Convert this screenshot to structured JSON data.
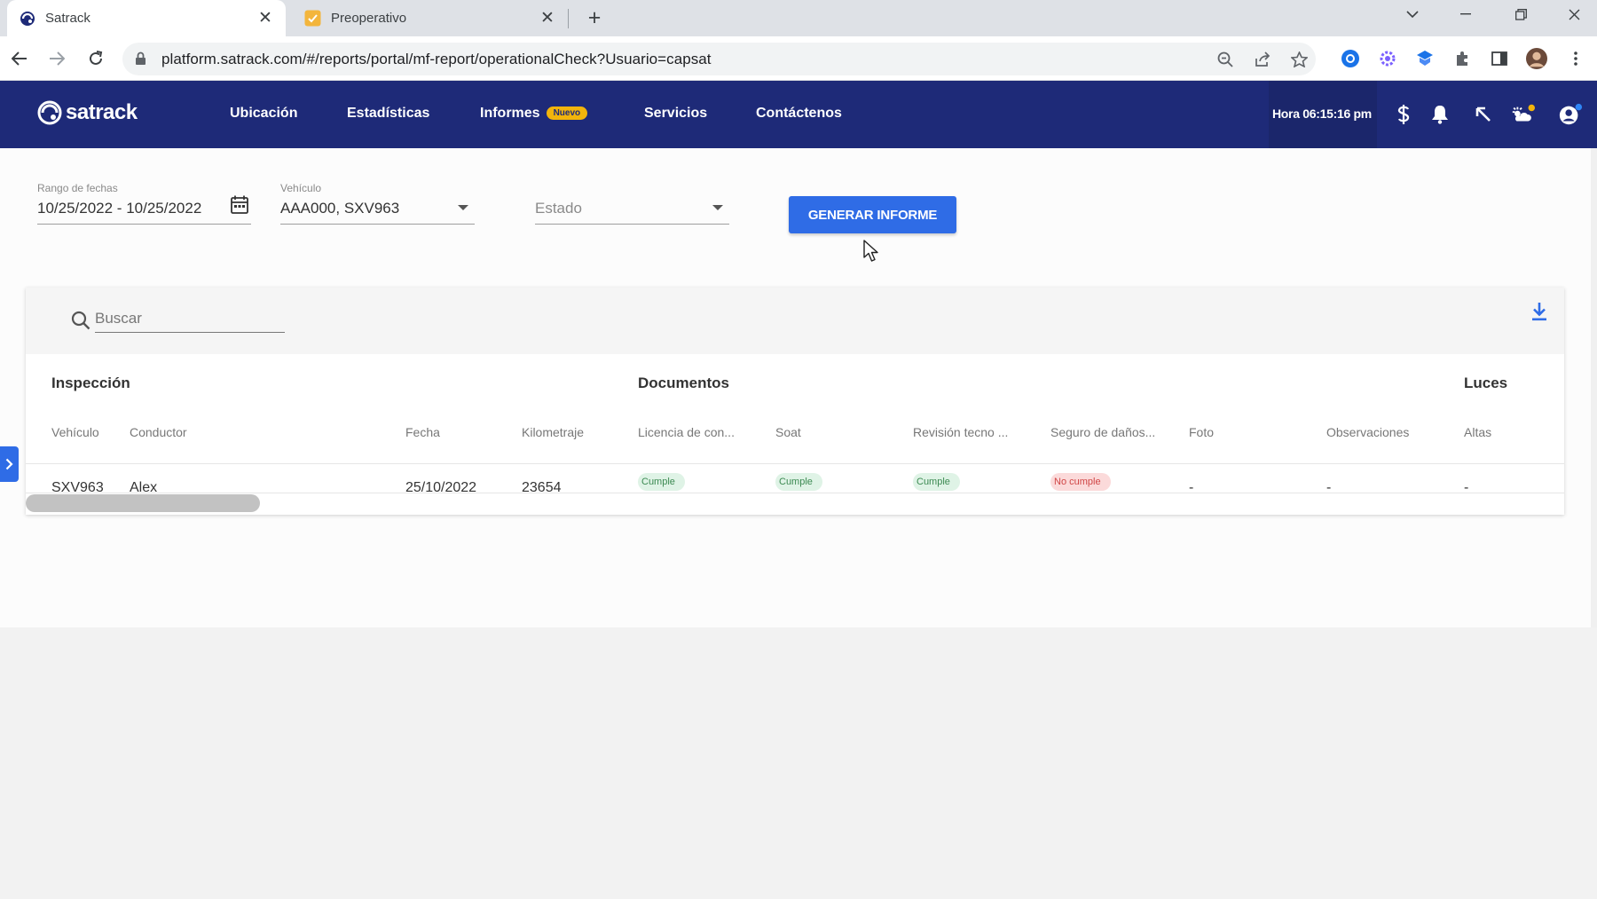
{
  "browser": {
    "tabs": [
      {
        "title": "Satrack",
        "active": true
      },
      {
        "title": "Preoperativo",
        "active": false
      }
    ],
    "url": "platform.satrack.com/#/reports/portal/mf-report/operationalCheck?Usuario=capsat"
  },
  "header": {
    "logo": "satrack",
    "nav": [
      {
        "label": "Ubicación"
      },
      {
        "label": "Estadísticas"
      },
      {
        "label": "Informes",
        "badge": "Nuevo"
      },
      {
        "label": "Servicios"
      },
      {
        "label": "Contáctenos"
      }
    ],
    "time": "Hora 06:15:16 pm",
    "icons": [
      "dollar-icon",
      "bell-icon",
      "pointer-icon",
      "weather-icon",
      "account-icon"
    ]
  },
  "filters": {
    "date_range": {
      "label": "Rango de fechas",
      "value": "10/25/2022 - 10/25/2022"
    },
    "vehicle": {
      "label": "Vehículo",
      "value": "AAA000, SXV963"
    },
    "status": {
      "placeholder": "Estado"
    },
    "generate_button": "GENERAR INFORME"
  },
  "table": {
    "search_placeholder": "Buscar",
    "groups": [
      "Inspección",
      "Documentos",
      "Luces"
    ],
    "columns": [
      "Vehículo",
      "Conductor",
      "Fecha",
      "Kilometraje",
      "Licencia de con...",
      "Soat",
      "Revisión tecno ...",
      "Seguro de daños...",
      "Foto",
      "Observaciones",
      "Altas"
    ],
    "rows": [
      {
        "vehiculo": "SXV963",
        "conductor": "Alex",
        "fecha": "25/10/2022",
        "kilometraje": "23654",
        "licencia": "Cumple",
        "soat": "Cumple",
        "revision": "Cumple",
        "seguro": "No cumple",
        "foto": "-",
        "observaciones": "-",
        "altas": "-"
      }
    ]
  },
  "colors": {
    "header_bg": "#1e2a78",
    "primary": "#2f6ce6",
    "badge": "#f2b40c",
    "ok_chip": "#dff3e6",
    "bad_chip": "#fbdada"
  }
}
